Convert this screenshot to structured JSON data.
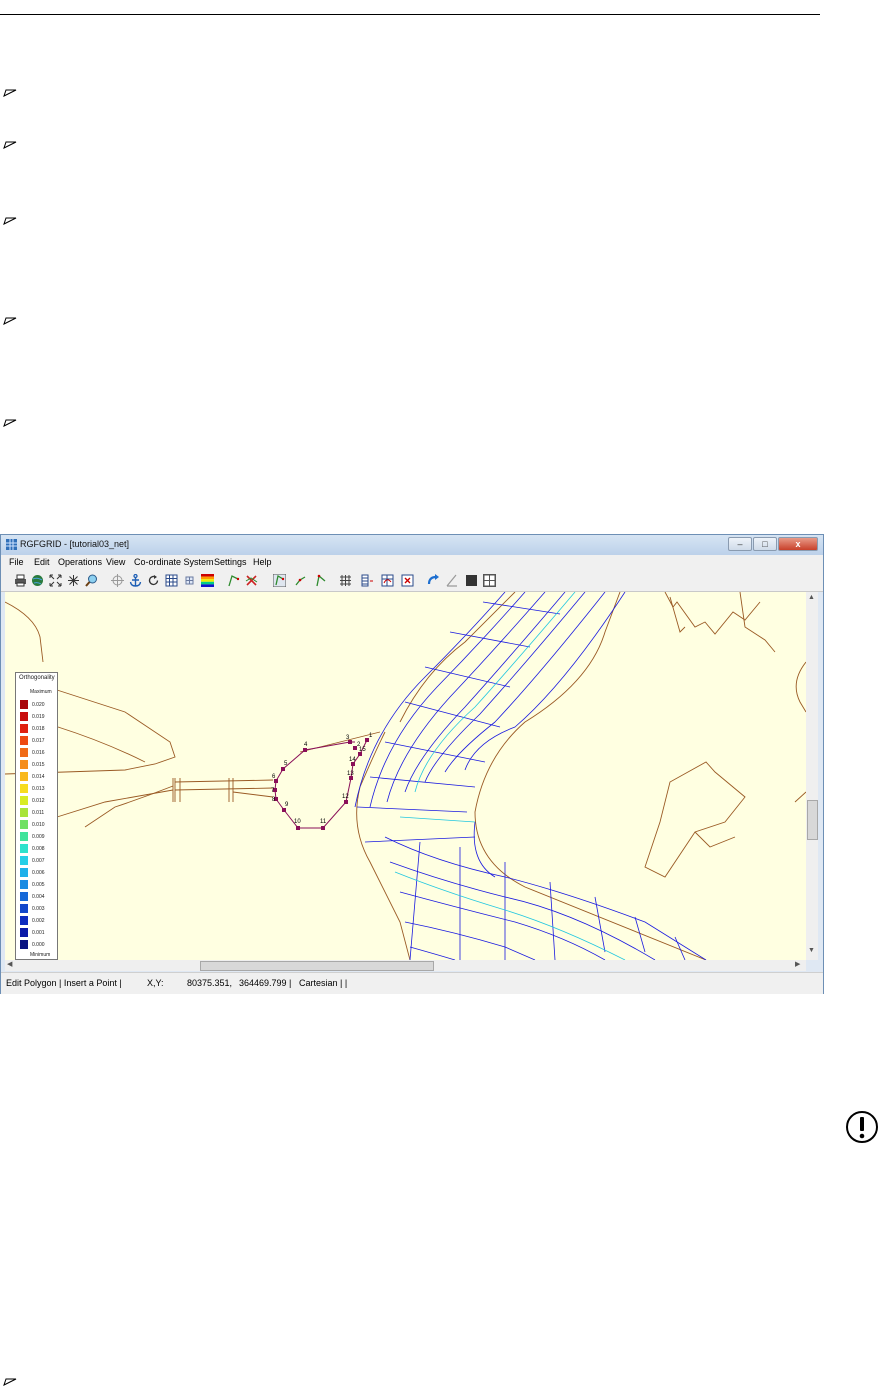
{
  "document": {
    "bullet_marker": "➢"
  },
  "window": {
    "title": "RGFGRID - [tutorial03_net]",
    "controls": {
      "minimize": "–",
      "maximize": "□",
      "close": "x"
    }
  },
  "menu": [
    "File",
    "Edit",
    "Operations",
    "View",
    "Co-ordinate System",
    "Settings",
    "Help"
  ],
  "toolbar_icons": [
    "print-icon",
    "globe-icon",
    "zoom-extents-icon",
    "zoom-to-center-icon",
    "zoom-glass-icon",
    "crosshair-icon",
    "anchor-icon",
    "refresh-icon",
    "grid-view-icon",
    "grid-small-icon",
    "colorbar-icon",
    "spline-new-icon",
    "spline-delete-icon",
    "polygon-new-icon",
    "polygon-edit-icon",
    "polygon-move-icon",
    "grid-from-splines-icon",
    "grid-refine-icon",
    "grid-orthogonalize-icon",
    "grid-point-icon",
    "redo-icon",
    "ruler-icon",
    "dark-square-icon",
    "windows-grid-icon"
  ],
  "legend": {
    "title": "Orthogonality",
    "top_label": "Maximum",
    "bottom_label": "Minimum",
    "items": [
      {
        "label": "0.020",
        "color": "#a8060b"
      },
      {
        "label": "0.019",
        "color": "#c80d0d"
      },
      {
        "label": "0.018",
        "color": "#e0200f"
      },
      {
        "label": "0.017",
        "color": "#ee4a12"
      },
      {
        "label": "0.016",
        "color": "#f06b17"
      },
      {
        "label": "0.015",
        "color": "#f58d1c"
      },
      {
        "label": "0.014",
        "color": "#f9b81d"
      },
      {
        "label": "0.013",
        "color": "#f7dc1e"
      },
      {
        "label": "0.012",
        "color": "#d8ec24"
      },
      {
        "label": "0.011",
        "color": "#a8e43a"
      },
      {
        "label": "0.010",
        "color": "#6fe063"
      },
      {
        "label": "0.009",
        "color": "#3fe39b"
      },
      {
        "label": "0.008",
        "color": "#2ee2cc"
      },
      {
        "label": "0.007",
        "color": "#27cfe7"
      },
      {
        "label": "0.006",
        "color": "#1fb0ea"
      },
      {
        "label": "0.005",
        "color": "#1a8be2"
      },
      {
        "label": "0.004",
        "color": "#1668d8"
      },
      {
        "label": "0.003",
        "color": "#1247cb"
      },
      {
        "label": "0.002",
        "color": "#0e2cbf"
      },
      {
        "label": "0.001",
        "color": "#0a1aa8"
      },
      {
        "label": "0.000",
        "color": "#081282"
      }
    ]
  },
  "polygon_points": [
    {
      "label": "1"
    },
    {
      "label": "2"
    },
    {
      "label": "3"
    },
    {
      "label": "4"
    },
    {
      "label": "5"
    },
    {
      "label": "6"
    },
    {
      "label": "7"
    },
    {
      "label": "8"
    },
    {
      "label": "9"
    },
    {
      "label": "10"
    },
    {
      "label": "11"
    },
    {
      "label": "12"
    },
    {
      "label": "13"
    },
    {
      "label": "14"
    },
    {
      "label": "15"
    }
  ],
  "status": {
    "mode": "Edit Polygon | Insert a Point |",
    "coord_label": "X,Y:",
    "x": "80375.351,",
    "y": "364469.799 |",
    "system": "Cartesian | |"
  },
  "colors": {
    "land_line": "#9a5a24",
    "grid_blue": "#1a1ae0",
    "grid_cyan": "#22c7e0",
    "polygon": "#8a0f59",
    "canvas_bg": "#ffffe1"
  }
}
